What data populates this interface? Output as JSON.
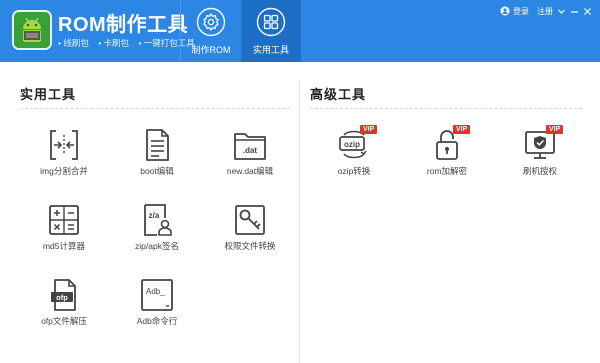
{
  "app": {
    "title": "ROM制作工具",
    "features": [
      "• 线刷包",
      "• 卡刷包",
      "• 一键打包工具"
    ]
  },
  "nav": {
    "tabs": [
      {
        "label": "制作ROM",
        "icon": "gear-icon",
        "active": false
      },
      {
        "label": "实用工具",
        "icon": "grid-icon",
        "active": true
      }
    ]
  },
  "user": {
    "login": "登录",
    "register": "注册"
  },
  "sections": {
    "practical": {
      "title": "实用工具",
      "tools": [
        {
          "label": "img分割合并",
          "icon": "split-merge-icon"
        },
        {
          "label": "boot编辑",
          "icon": "document-icon"
        },
        {
          "label": "new.dat编辑",
          "icon": "dat-folder-icon"
        },
        {
          "label": "md5计算器",
          "icon": "calculator-icon"
        },
        {
          "label": "zip/apk签名",
          "icon": "signature-icon"
        },
        {
          "label": "权限文件转换",
          "icon": "key-icon"
        },
        {
          "label": "ofp文件解压",
          "icon": "ofp-file-icon"
        },
        {
          "label": "Adb命令行",
          "icon": "terminal-icon"
        }
      ]
    },
    "advanced": {
      "title": "高级工具",
      "tools": [
        {
          "label": "ozip转换",
          "icon": "ozip-convert-icon",
          "badge": "VIP"
        },
        {
          "label": "rom加解密",
          "icon": "lock-icon",
          "badge": "VIP"
        },
        {
          "label": "刷机授权",
          "icon": "shield-monitor-icon",
          "badge": "VIP"
        }
      ]
    }
  },
  "colors": {
    "header": "#2b87e3",
    "active_tab": "#1c6fc4",
    "vip_badge": "#e3312b",
    "icon_stroke": "#444444"
  }
}
